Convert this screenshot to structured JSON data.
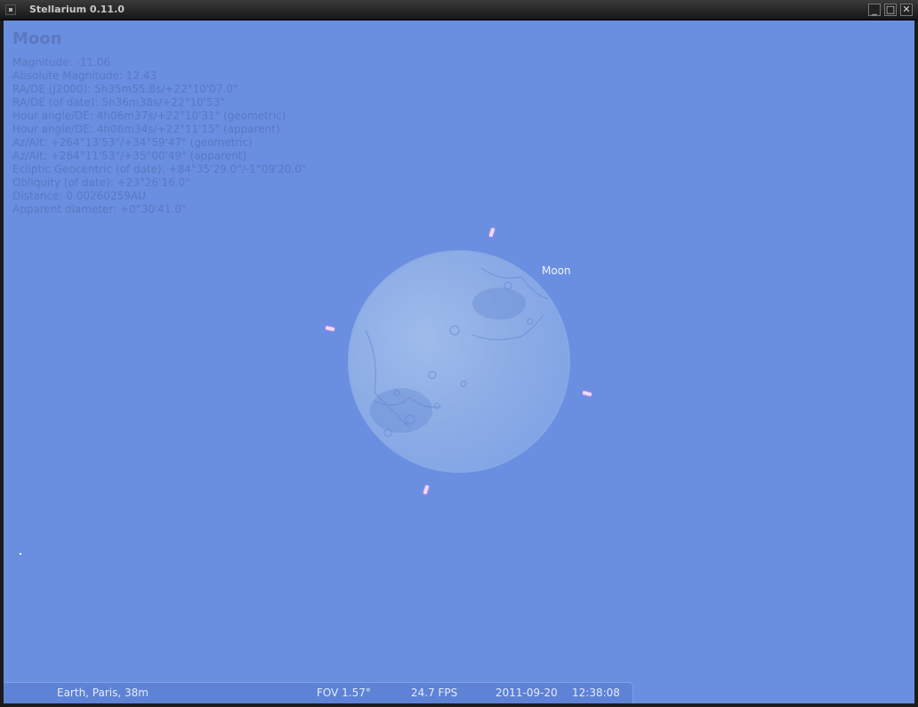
{
  "window": {
    "title": "Stellarium 0.11.0",
    "minimize_icon": "minimize-icon",
    "maximize_icon": "maximize-icon",
    "close_icon": "close-icon",
    "buttons": {
      "minimize": "_",
      "maximize": "□",
      "close": "✕"
    }
  },
  "object_info": {
    "name": "Moon",
    "lines": [
      "Magnitude: -11.06",
      "Absolute Magnitude: 12.43",
      "RA/DE (J2000): 5h35m55.8s/+22°10'07.0\"",
      "RA/DE (of date): 5h36m38s/+22°10'53\"",
      "Hour angle/DE: 4h06m37s/+22°10'31\" (geometric)",
      "Hour angle/DE: 4h06m34s/+22°11'15\" (apparent)",
      "Az/Alt: +264°13'53\"/+34°59'47\" (geometric)",
      "Az/Alt: +264°11'53\"/+35°00'49\" (apparent)",
      "Ecliptic Geocentric (of date): +84°35'29.0\"/-1°09'20.0\"",
      "Obliquity (of date): +23°26'16.0\"",
      "Distance: 0.00260259AU",
      "Apparent diameter: +0°30'41.0\""
    ]
  },
  "sky": {
    "object_label": "Moon",
    "sky_color": "#6a8fe0"
  },
  "status_bar": {
    "location": "Earth, Paris, 38m",
    "fov": "FOV 1.57°",
    "fps": "24.7 FPS",
    "date": "2011-09-20",
    "time": "12:38:08"
  }
}
